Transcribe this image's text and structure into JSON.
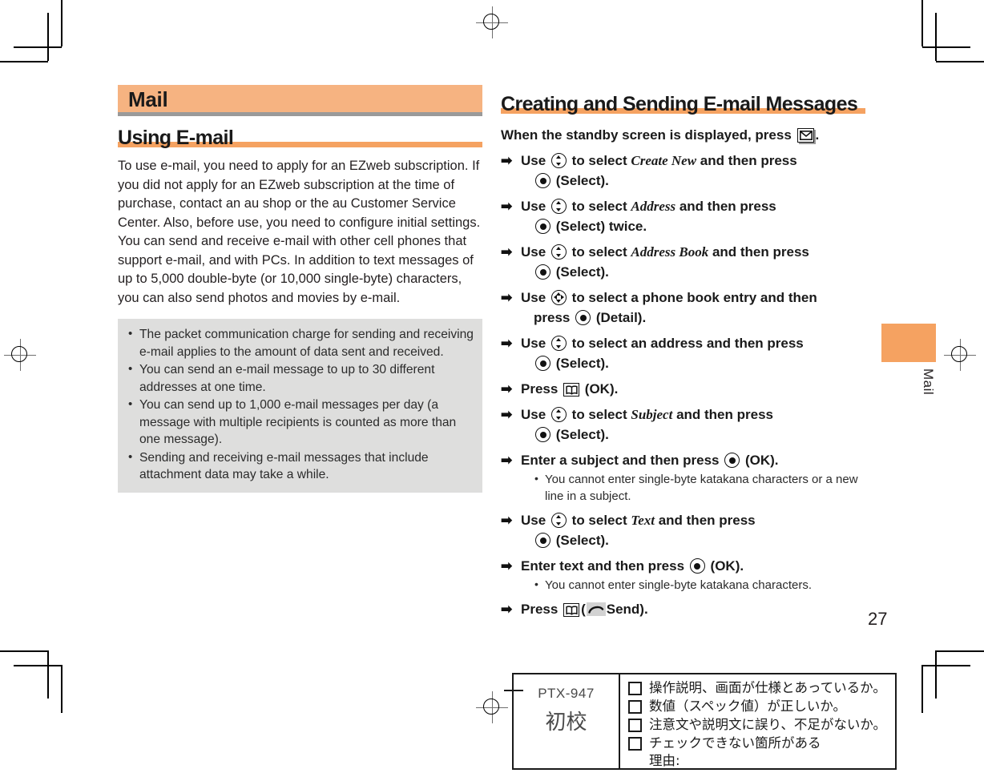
{
  "chapter": {
    "banner_label": "Mail",
    "thumb_tab_label": "Mail",
    "accent_orange": "#f5a261",
    "banner_orange": "#f6b381",
    "note_gray": "#dededd"
  },
  "page_number": "27",
  "left_column": {
    "section_title": "Using E-mail",
    "paragraphs": [
      "To use e-mail, you need to apply for an EZweb subscription. If you did not apply for an EZweb subscription at the time of purchase, contact an au shop or the au Customer Service Center. Also, before use, you need to configure initial settings.",
      "You can send and receive e-mail with other cell phones that support e-mail, and with PCs. In addition to text messages of up to 5,000 double-byte (or 10,000 single-byte) characters, you can also send photos and movies by e-mail."
    ],
    "notes": [
      "The packet communication charge for sending and receiving e-mail applies to the amount of data sent and received.",
      "You can send an e-mail message to up to 30 different addresses at one time.",
      "You can send up to 1,000 e-mail messages per day (a message with multiple recipients is counted as more than one message).",
      "Sending and receiving e-mail messages that include attachment data may take a while."
    ]
  },
  "right_column": {
    "section_title": "Creating and Sending E-mail Messages",
    "lead": {
      "before": "When the standby screen is displayed, press",
      "icon": "mail-key-icon",
      "after": "."
    },
    "steps": [
      {
        "arrow": "➡",
        "line1_pre": "Use",
        "icon1": "updown-nav-key-icon",
        "line1_mid": "to select",
        "italic": "Create New",
        "line1_post": "and then press",
        "icon2": "center-select-key-icon",
        "line2": "(Select)."
      },
      {
        "arrow": "➡",
        "line1_pre": "Use",
        "icon1": "updown-nav-key-icon",
        "line1_mid": "to select",
        "italic": "Address",
        "line1_post": "and then press",
        "icon2": "center-select-key-icon",
        "line2": "(Select) twice."
      },
      {
        "arrow": "➡",
        "line1_pre": "Use",
        "icon1": "updown-nav-key-icon",
        "line1_mid": "to select",
        "italic": "Address Book",
        "line1_post": "and then press",
        "icon2": "center-select-key-icon",
        "line2": "(Select)."
      },
      {
        "arrow": "➡",
        "line1_pre": "Use",
        "icon1": "fourway-nav-key-icon",
        "line1_mid": "to select a phone book entry and then",
        "italic": "",
        "line1_post": "",
        "line2_pre": "press",
        "icon2": "center-select-key-icon",
        "line2": "(Detail)."
      },
      {
        "arrow": "➡",
        "line1_pre": "Use",
        "icon1": "updown-nav-key-icon",
        "line1_mid": "to select an address and then press",
        "italic": "",
        "line1_post": "",
        "icon2": "center-select-key-icon",
        "line2": "(Select)."
      },
      {
        "arrow": "➡",
        "line1_pre": "Press",
        "icon1": "book-soft-key-icon",
        "line1_mid": "(OK).",
        "italic": "",
        "line1_post": ""
      },
      {
        "arrow": "➡",
        "line1_pre": "Use",
        "icon1": "updown-nav-key-icon",
        "line1_mid": "to select",
        "italic": "Subject",
        "line1_post": "and then press",
        "icon2": "center-select-key-icon",
        "line2": "(Select)."
      },
      {
        "arrow": "➡",
        "line1_pre": "Enter a subject and then press",
        "icon1": "center-select-key-icon",
        "line1_mid": "(OK).",
        "italic": "",
        "line1_post": "",
        "subnotes": [
          "You cannot enter single-byte katakana characters or a new line in a subject."
        ]
      },
      {
        "arrow": "➡",
        "line1_pre": "Use",
        "icon1": "updown-nav-key-icon",
        "line1_mid": "to select",
        "italic": "Text",
        "line1_post": "and then press",
        "icon2": "center-select-key-icon",
        "line2": "(Select)."
      },
      {
        "arrow": "➡",
        "line1_pre": "Enter text and then press",
        "icon1": "center-select-key-icon",
        "line1_mid": "(OK).",
        "italic": "",
        "line1_post": "",
        "subnotes": [
          "You cannot enter single-byte katakana characters."
        ]
      },
      {
        "arrow": "➡",
        "line1_pre": "Press",
        "icon1": "book-soft-key-icon",
        "line1_mid": "(",
        "icon_send": "send-call-key-icon",
        "line1_post": "Send)."
      }
    ]
  },
  "proof_stamp": {
    "job_number": "PTX-947",
    "stage": "初校",
    "checks": [
      {
        "line1": "操作説明、画面が仕様とあっているか。",
        "line2": ""
      },
      {
        "line1": "数値（スペック値）が正しいか。",
        "line2": ""
      },
      {
        "line1": "注意文や説明文に誤り、不足がないか。",
        "line2": ""
      },
      {
        "line1": "チェックできない箇所がある",
        "line2": "理由:"
      }
    ]
  }
}
